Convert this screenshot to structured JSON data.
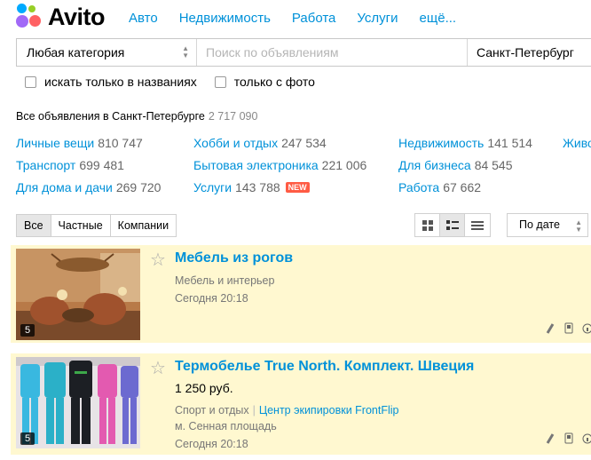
{
  "header": {
    "logo_text": "Avito",
    "nav": [
      "Авто",
      "Недвижимость",
      "Работа",
      "Услуги",
      "ещё..."
    ]
  },
  "search": {
    "category": "Любая категория",
    "placeholder": "Поиск по объявлениям",
    "city": "Санкт-Петербург",
    "only_titles": "искать только в названиях",
    "only_photo": "только с фото"
  },
  "summary": {
    "label": "Все объявления в Санкт-Петербурге",
    "count": "2 717 090"
  },
  "categories": [
    {
      "name": "Личные вещи",
      "count": "810 747"
    },
    {
      "name": "Транспорт",
      "count": "699 481"
    },
    {
      "name": "Для дома и дачи",
      "count": "269 720"
    },
    {
      "name": "Хобби и отдых",
      "count": "247 534"
    },
    {
      "name": "Бытовая электроника",
      "count": "221 006"
    },
    {
      "name": "Услуги",
      "count": "143 788",
      "badge": "NEW"
    },
    {
      "name": "Недвижимость",
      "count": "141 514"
    },
    {
      "name": "Для бизнеса",
      "count": "84 545"
    },
    {
      "name": "Работа",
      "count": "67 662"
    },
    {
      "name": "Живо"
    }
  ],
  "filters": [
    "Все",
    "Частные",
    "Компании"
  ],
  "sort": "По дате",
  "listings": [
    {
      "title": "Мебель из рогов",
      "category": "Мебель и интерьер",
      "date": "Сегодня 20:18",
      "photos": "5"
    },
    {
      "title": "Термобелье True North. Комплект. Швеция",
      "price": "1 250 руб.",
      "category": "Спорт и отдых",
      "shop": "Центр экипировки FrontFlip",
      "location": "м. Сенная площадь",
      "date": "Сегодня 20:18",
      "photos": "5"
    }
  ],
  "colors": {
    "link": "#0091d9",
    "listing_bg": "#fff8d0",
    "badge": "#ff5b44"
  }
}
